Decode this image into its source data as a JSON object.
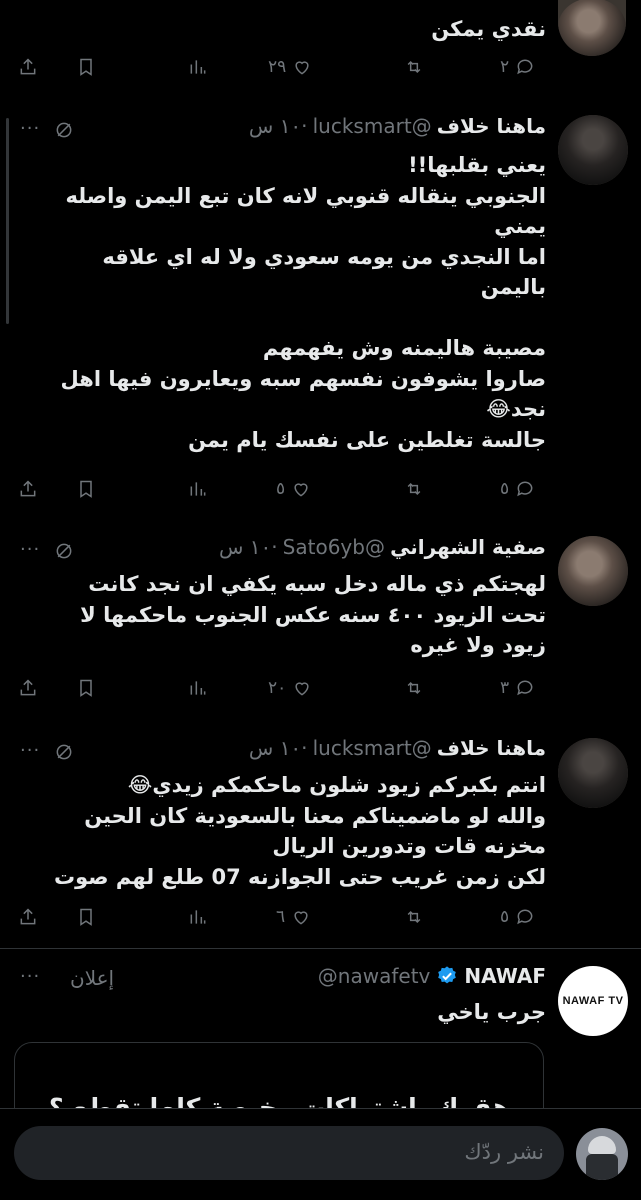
{
  "top_tweet": {
    "text": "نقدي يمكن",
    "replies": "٢",
    "likes": "٢٩"
  },
  "tweets": [
    {
      "name": "ماهنا خلاف",
      "handle": "@lucksmart",
      "time": "١٠ س",
      "lines": [
        "يعني بقلبها!!",
        "الجنوبي ينقاله قنوبي لانه كان تبع اليمن واصله",
        "يمني",
        "اما النجدي من يومه سعودي ولا له اي علاقه",
        "باليمن",
        "",
        "مصيبة هاليمنه وش يفهمهم",
        "صاروا يشوفون نفسهم سبه ويعايرون فيها اهل",
        "نجد😂",
        "جالسة تغلطين على نفسك يام يمن"
      ],
      "replies": "٥",
      "likes": "٥"
    },
    {
      "name": "صفية الشهراني",
      "handle": "@Sato6yb",
      "time": "١٠ س",
      "lines": [
        "لهجتكم ذي ماله دخل سبه يكفي ان نجد كانت",
        "تحت الزيود ٤٠٠ سنه عكس الجنوب ماحكمها لا",
        "زيود ولا غيره"
      ],
      "replies": "٣",
      "likes": "٢٠"
    },
    {
      "name": "ماهنا خلاف",
      "handle": "@lucksmart",
      "time": "١٠ س",
      "lines": [
        "انتم بكبركم زيود شلون ماحكمكم زيدي😂",
        "والله لو ماضميناكم معنا بالسعودية كان الحين",
        "مخزنه قات وتدورين الريال",
        "لكن زمن غريب حتى الجوازنه 07 طلع لهم صوت"
      ],
      "replies": "٥",
      "likes": "٦"
    }
  ],
  "ad": {
    "name": "NAWAF",
    "handle": "@nawafetv",
    "label": "إعلان",
    "text": "جرب ياخي",
    "card_text": "وهقوك باشتراكات رخيصة كلها تقطع ؟",
    "avatar_text": "NAWAF TV"
  },
  "reply_bar": {
    "placeholder": "نشر ردّك"
  },
  "colors": {
    "background": "#000000",
    "text": "#e7e9ea",
    "muted": "#71767b",
    "verified": "#1d9bf0"
  },
  "icons": [
    "share-icon",
    "bookmark-icon",
    "views-icon",
    "like-icon",
    "retweet-icon",
    "reply-icon",
    "mute-icon",
    "more-icon",
    "verified-icon"
  ]
}
